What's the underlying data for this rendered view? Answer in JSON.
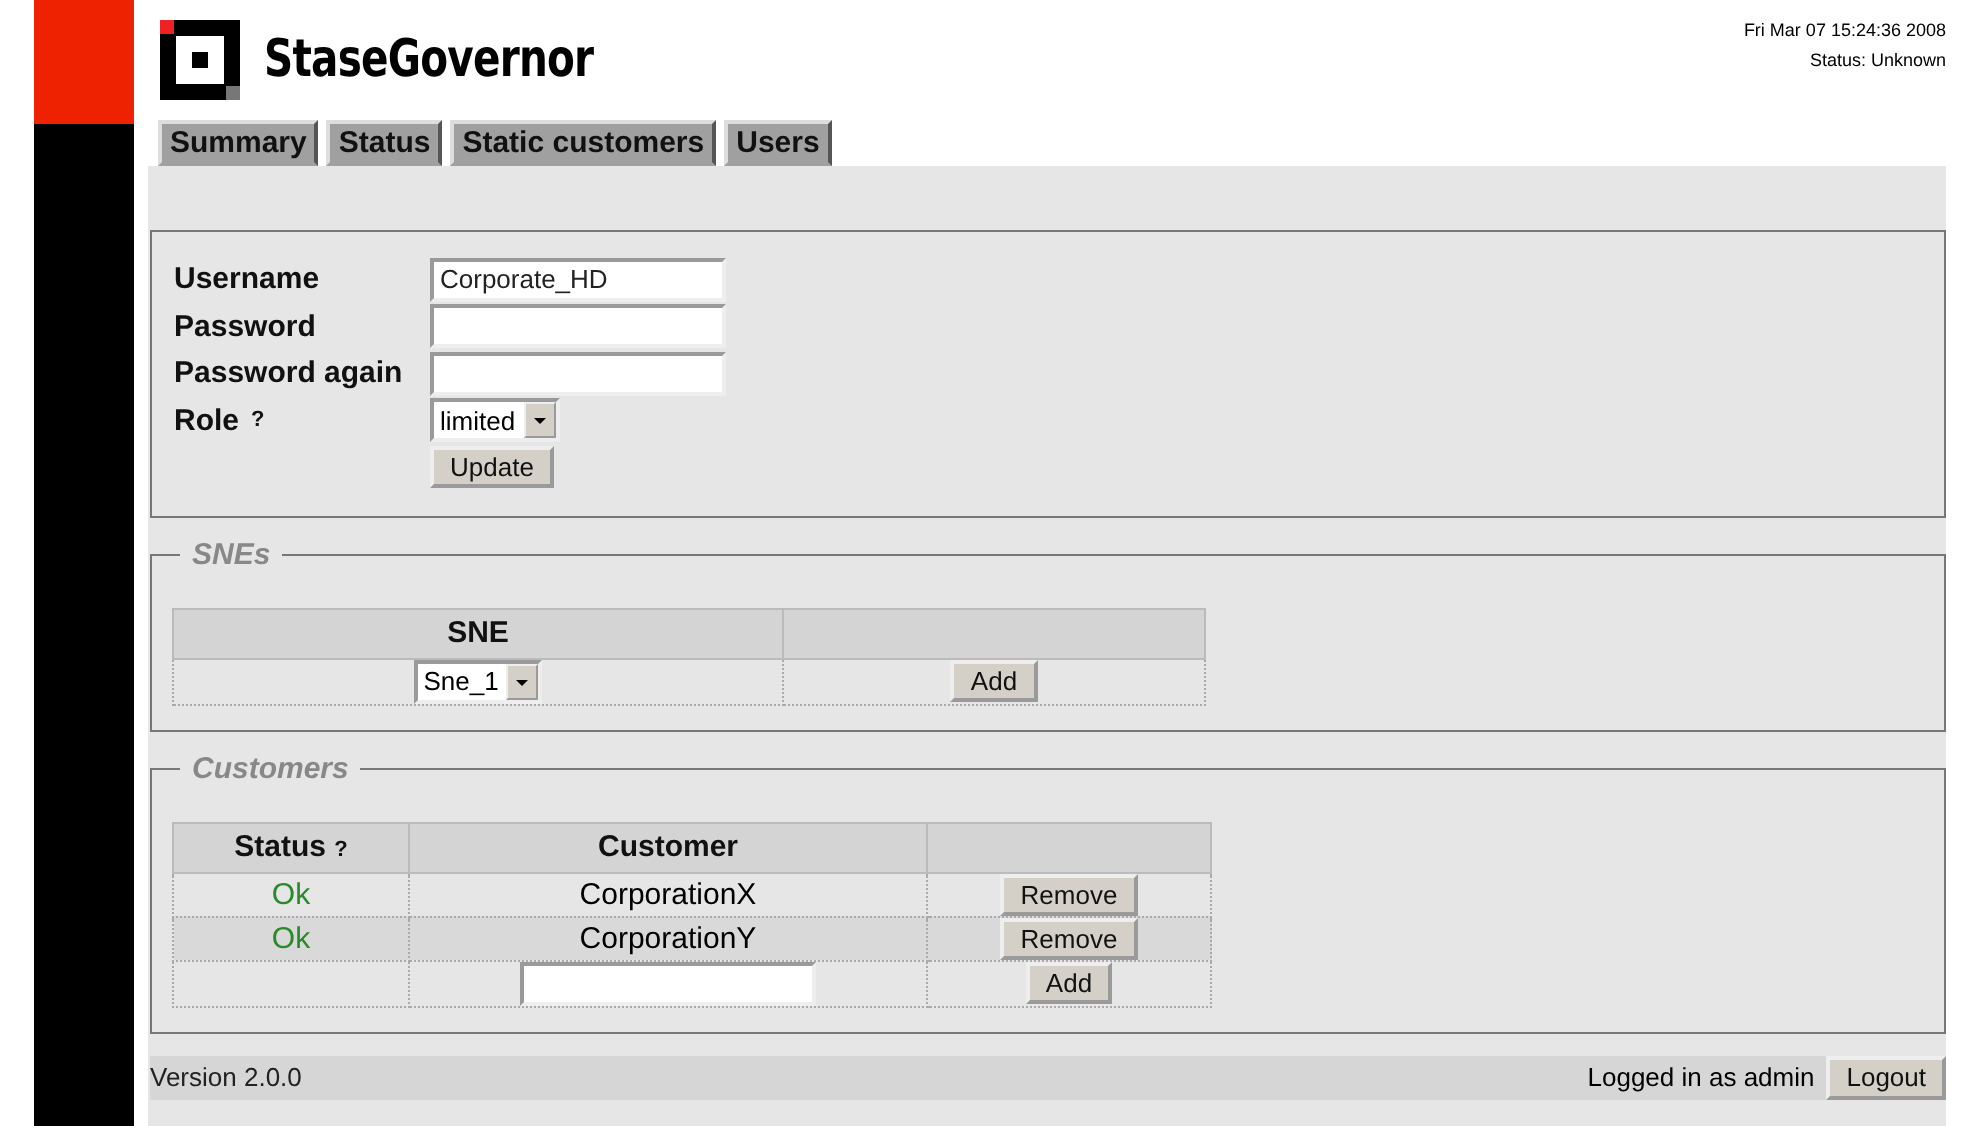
{
  "app": {
    "name": "StaseGovernor",
    "datetime": "Fri Mar 07 15:24:36 2008",
    "status": "Status: Unknown"
  },
  "tabs": [
    {
      "label": "Summary"
    },
    {
      "label": "Status"
    },
    {
      "label": "Static customers"
    },
    {
      "label": "Users"
    }
  ],
  "user_form": {
    "fields": [
      {
        "kind": "text",
        "label": "Username",
        "value": "Corporate_HD"
      },
      {
        "kind": "text",
        "label": "Password"
      },
      {
        "kind": "text",
        "label": "Password again"
      },
      {
        "kind": "select",
        "label": "Role",
        "help": "?",
        "value": "limited"
      }
    ],
    "button": "Update"
  },
  "snes": {
    "legend": "SNEs",
    "columns": [
      {
        "label": "SNE"
      },
      {}
    ],
    "select_value": "Sne_1",
    "button": "Add"
  },
  "customers": {
    "legend": "Customers",
    "columns": [
      {
        "label": "Status",
        "help": "?"
      },
      {
        "label": "Customer"
      },
      {}
    ],
    "rows": [
      {
        "status": "Ok",
        "customer": "CorporationX",
        "button": "Remove"
      },
      {
        "status": "Ok",
        "customer": "CorporationY",
        "button": "Remove"
      }
    ],
    "add_button": "Add"
  },
  "footer": {
    "version": "Version 2.0.0",
    "user": "Logged in as admin",
    "logout": "Logout"
  }
}
